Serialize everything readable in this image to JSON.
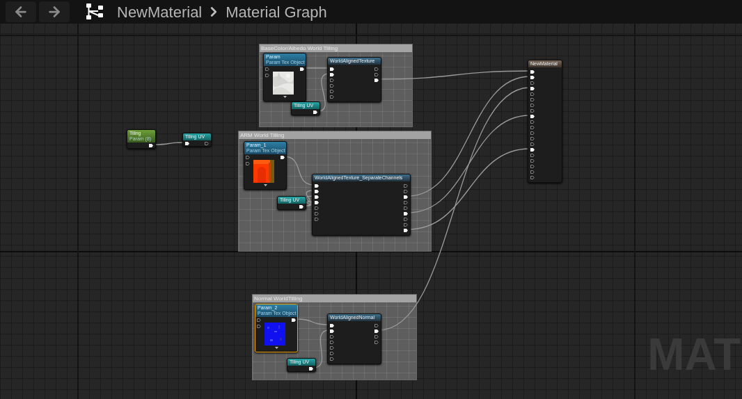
{
  "toolbar": {
    "breadcrumb": [
      {
        "label": "NewMaterial"
      },
      {
        "label": "Material Graph"
      }
    ]
  },
  "comments": [
    {
      "title": "BaseColor/Albedo World Tilling"
    },
    {
      "title": "ARM World Tilling"
    },
    {
      "title": "Normal WorldTilling"
    }
  ],
  "nodes": [
    {
      "kind": "texture",
      "title": "Param",
      "subtitle": "Param Tex Object",
      "selected": false,
      "inputs": [
        {
          "connected": false
        },
        {
          "connected": false
        }
      ],
      "outputs": [
        {
          "connected": true
        }
      ]
    },
    {
      "kind": "function",
      "title": "WorldAlignedTexture",
      "selected": false,
      "inputs": [
        {
          "connected": true
        },
        {
          "connected": true
        },
        {
          "connected": false
        },
        {
          "connected": false
        },
        {
          "connected": false
        },
        {
          "connected": false
        }
      ],
      "outputs": [
        {
          "connected": false
        },
        {
          "connected": false
        },
        {
          "connected": true
        }
      ]
    },
    {
      "kind": "uv",
      "title": "Tiling UV",
      "selected": false,
      "outputs": [
        {
          "connected": true
        }
      ]
    },
    {
      "kind": "param",
      "title": "Tiling",
      "subtitle": "Param (8)",
      "selected": false,
      "outputs": [
        {
          "connected": true
        }
      ]
    },
    {
      "kind": "uv",
      "title": "Tiling UV",
      "selected": false,
      "inputs": [
        {
          "connected": true
        }
      ],
      "outputs": [
        {
          "connected": false
        }
      ]
    },
    {
      "kind": "texture",
      "title": "Param_1",
      "subtitle": "Param Tex Object",
      "selected": false,
      "inputs": [
        {
          "connected": false
        },
        {
          "connected": false
        }
      ],
      "outputs": [
        {
          "connected": true
        }
      ]
    },
    {
      "kind": "function",
      "title": "WorldAlignedTexture_SeparateChannels",
      "selected": false,
      "inputs": [
        {
          "connected": true
        },
        {
          "connected": true
        },
        {
          "connected": true
        },
        {
          "connected": true
        },
        {
          "connected": false
        },
        {
          "connected": false
        },
        {
          "connected": false
        }
      ],
      "outputs": [
        {
          "connected": false
        },
        {
          "connected": false
        },
        {
          "connected": true
        },
        {
          "connected": false
        },
        {
          "connected": false
        },
        {
          "connected": true
        },
        {
          "connected": false
        },
        {
          "connected": false
        },
        {
          "connected": true
        }
      ]
    },
    {
      "kind": "uv",
      "title": "Tiling UV",
      "selected": false,
      "outputs": [
        {
          "connected": true
        }
      ]
    },
    {
      "kind": "texture",
      "title": "Param_2",
      "subtitle": "Param Tex Object",
      "selected": true,
      "inputs": [
        {
          "connected": false
        },
        {
          "connected": false
        }
      ],
      "outputs": [
        {
          "connected": true
        }
      ]
    },
    {
      "kind": "function",
      "title": "WorldAlignedNormal",
      "selected": false,
      "inputs": [
        {
          "connected": true
        },
        {
          "connected": true
        },
        {
          "connected": false
        },
        {
          "connected": false
        },
        {
          "connected": false
        },
        {
          "connected": false
        },
        {
          "connected": false
        }
      ],
      "outputs": [
        {
          "connected": false
        },
        {
          "connected": true
        },
        {
          "connected": false
        },
        {
          "connected": false
        }
      ]
    },
    {
      "kind": "uv",
      "title": "Tiling UV",
      "selected": false,
      "outputs": [
        {
          "connected": true
        }
      ]
    },
    {
      "kind": "result",
      "title": "NewMaterial",
      "selected": false,
      "inputs": [
        {
          "connected": true
        },
        {
          "connected": true
        },
        {
          "connected": false
        },
        {
          "connected": true
        },
        {
          "connected": false
        },
        {
          "connected": false
        },
        {
          "connected": false
        },
        {
          "connected": false
        },
        {
          "connected": true
        },
        {
          "connected": false
        },
        {
          "connected": false
        },
        {
          "connected": false
        },
        {
          "connected": false
        },
        {
          "connected": false
        },
        {
          "connected": true
        },
        {
          "connected": false
        },
        {
          "connected": false
        },
        {
          "connected": false
        },
        {
          "connected": false
        },
        {
          "connected": false
        }
      ]
    }
  ],
  "graph_label": "MAT"
}
